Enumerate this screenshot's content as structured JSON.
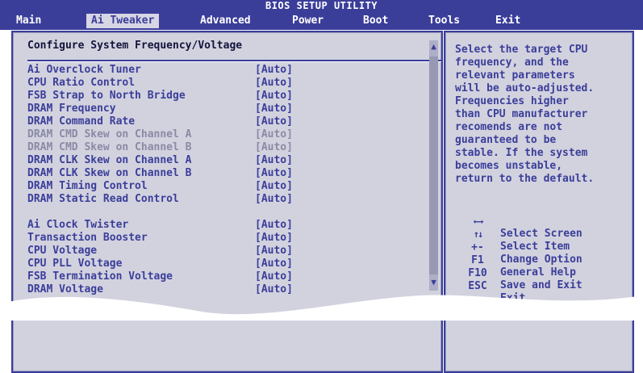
{
  "header": {
    "title": "BIOS SETUP UTILITY"
  },
  "menu": {
    "tabs": [
      {
        "label": "Main"
      },
      {
        "label": "Ai Tweaker"
      },
      {
        "label": "Advanced"
      },
      {
        "label": "Power"
      },
      {
        "label": "Boot"
      },
      {
        "label": "Tools"
      },
      {
        "label": "Exit"
      }
    ],
    "active": "Ai Tweaker"
  },
  "main": {
    "title": "Configure System Frequency/Voltage",
    "settings": [
      {
        "label": "Ai Overclock Tuner",
        "value": "[Auto]",
        "enabled": true
      },
      {
        "label": "CPU Ratio Control",
        "value": "[Auto]",
        "enabled": true
      },
      {
        "label": "FSB Strap to North Bridge",
        "value": "[Auto]",
        "enabled": true
      },
      {
        "label": "DRAM Frequency",
        "value": "[Auto]",
        "enabled": true
      },
      {
        "label": "DRAM Command Rate",
        "value": "[Auto]",
        "enabled": true
      },
      {
        "label": "DRAM CMD Skew on Channel A",
        "value": "[Auto]",
        "enabled": false
      },
      {
        "label": "DRAM CMD Skew on Channel B",
        "value": "[Auto]",
        "enabled": false
      },
      {
        "label": "DRAM CLK Skew on Channel A",
        "value": "[Auto]",
        "enabled": true
      },
      {
        "label": "DRAM CLK Skew on Channel B",
        "value": "[Auto]",
        "enabled": true
      },
      {
        "label": "DRAM Timing Control",
        "value": "[Auto]",
        "enabled": true
      },
      {
        "label": "DRAM Static Read Control",
        "value": "[Auto]",
        "enabled": true
      },
      {
        "label": "Ai Clock Twister",
        "value": "[Auto]",
        "enabled": true
      },
      {
        "label": "Transaction Booster",
        "value": "[Auto]",
        "enabled": true
      },
      {
        "label": "CPU Voltage",
        "value": "[Auto]",
        "enabled": true
      },
      {
        "label": "CPU PLL Voltage",
        "value": "[Auto]",
        "enabled": true
      },
      {
        "label": "FSB Termination Voltage",
        "value": "[Auto]",
        "enabled": true
      },
      {
        "label": "DRAM Voltage",
        "value": "[Auto]",
        "enabled": true
      }
    ]
  },
  "help": {
    "lines": [
      "Select the target CPU",
      "frequency, and the",
      "relevant parameters",
      "will be auto-adjusted.",
      "Frequencies higher",
      "than CPU manufacturer",
      "recomends are not",
      "guaranteed to be",
      "stable. If the system",
      "becomes unstable,",
      "return to the default."
    ],
    "keys": [
      {
        "key": "",
        "icon": "left-right-arrows-icon",
        "desc": "Select Screen"
      },
      {
        "key": "",
        "icon": "up-down-arrows-icon",
        "desc": "Select Item"
      },
      {
        "key": "+-",
        "desc": "Change Option"
      },
      {
        "key": "F1",
        "desc": "General Help"
      },
      {
        "key": "F10",
        "desc": "Save and Exit"
      },
      {
        "key": "ESC",
        "desc": "Exit"
      }
    ]
  },
  "colors": {
    "header_bg": "#3b3e99",
    "panel_bg": "#d2d2df",
    "text": "#3b3e99",
    "disabled_text": "#8a8aa5"
  }
}
